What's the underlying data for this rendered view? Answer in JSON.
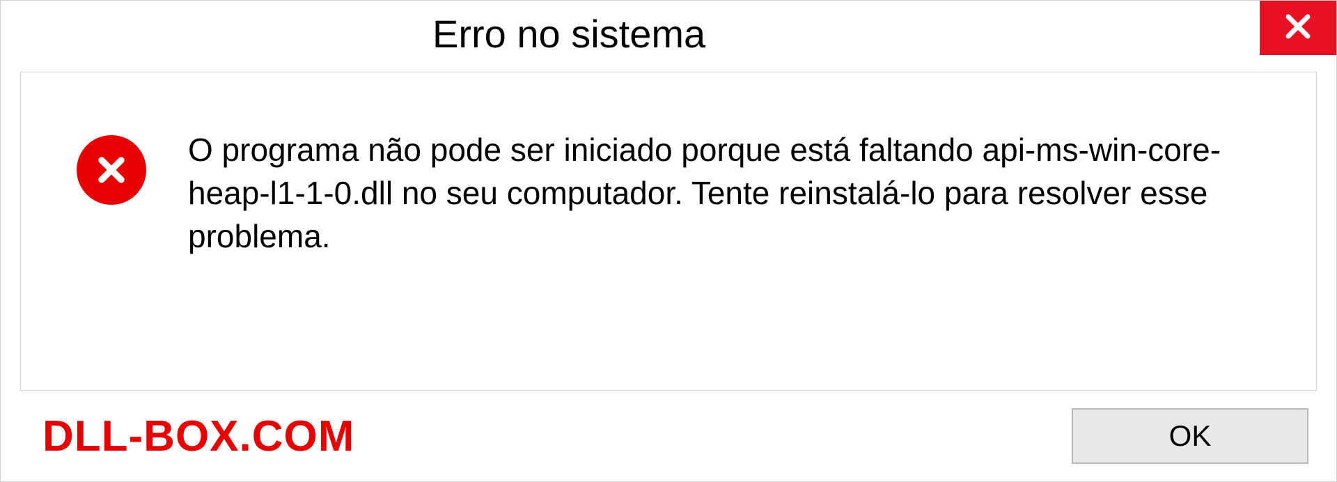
{
  "titlebar": {
    "title": "Erro no sistema"
  },
  "content": {
    "message": "O programa não pode ser iniciado porque está faltando api-ms-win-core-heap-l1-1-0.dll no seu computador. Tente reinstalá-lo para resolver esse problema."
  },
  "footer": {
    "watermark": "DLL-BOX.COM",
    "ok_label": "OK"
  }
}
